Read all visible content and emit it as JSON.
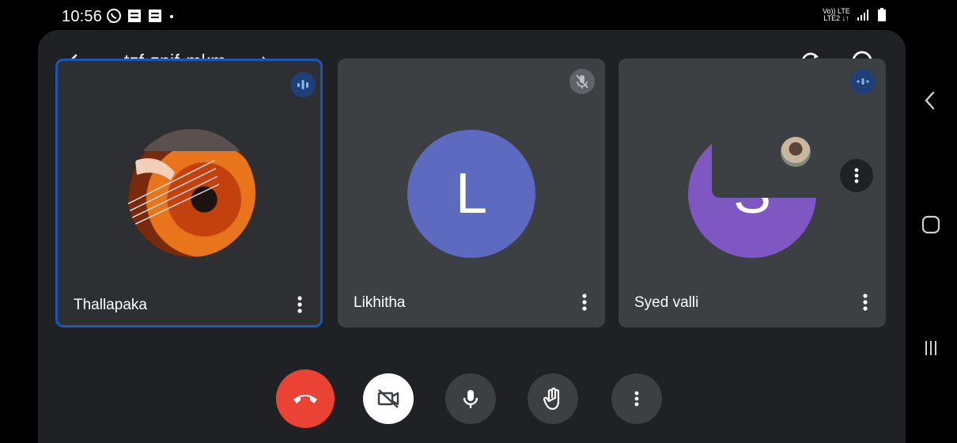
{
  "status_bar": {
    "time": "10:56",
    "net_top": "Vo)) LTE",
    "net_bottom": "LTE2 ↓↑"
  },
  "header": {
    "meeting_code": "tzf-znif-mkm"
  },
  "participants": [
    {
      "name": "Thallapaka",
      "active_speaker": true
    },
    {
      "name": "Likhitha",
      "initial": "L",
      "avatar_color": "#5c6bc0",
      "muted": true
    },
    {
      "name": "Syed valli",
      "initial": "S",
      "avatar_color": "#7e57c2"
    }
  ],
  "colors": {
    "background": "#202124",
    "tile": "#3c4043",
    "active_border": "#1a57b8",
    "end_call": "#ea4335"
  },
  "controls": [
    "end-call",
    "camera-off",
    "microphone",
    "raise-hand",
    "more-options"
  ]
}
